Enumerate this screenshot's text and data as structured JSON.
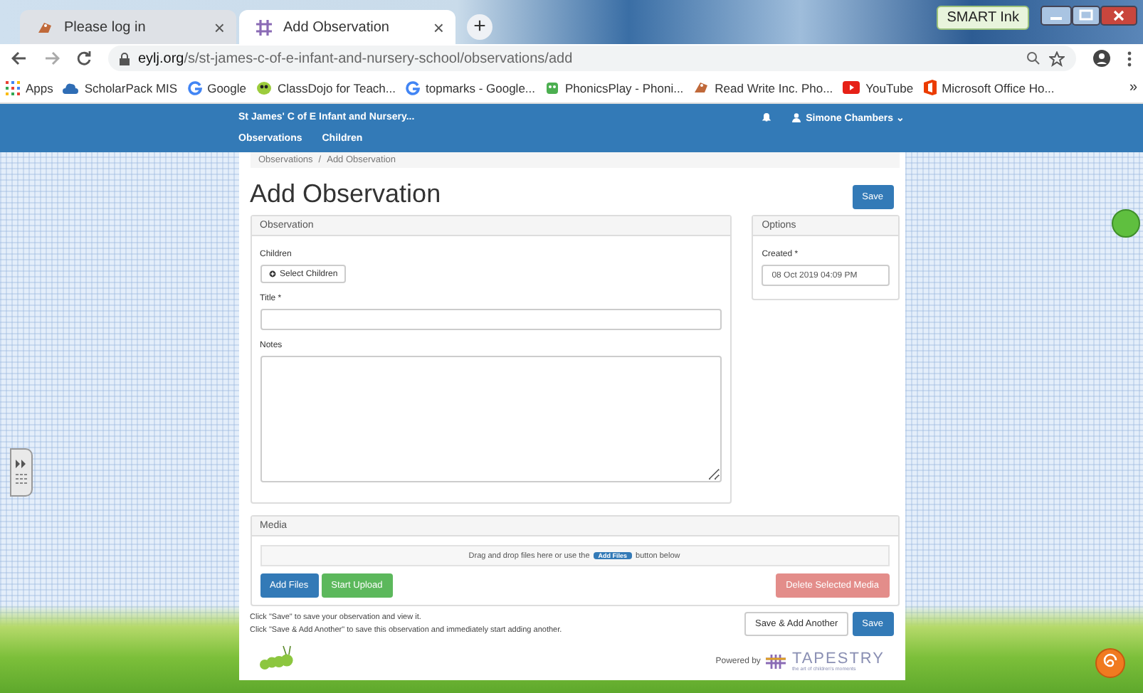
{
  "browser": {
    "tabs": [
      {
        "title": "Please log in",
        "close": "×",
        "selected": false
      },
      {
        "title": "Add Observation",
        "close": "×",
        "selected": true
      }
    ],
    "new_tab": "+",
    "smart_ink": "SMART Ink",
    "url_host": "eylj.org",
    "url_path": "/s/st-james-c-of-e-infant-and-nursery-school/observations/add",
    "bookmarks": [
      {
        "label": "Apps"
      },
      {
        "label": "ScholarPack MIS"
      },
      {
        "label": "Google"
      },
      {
        "label": "ClassDojo for Teach..."
      },
      {
        "label": "topmarks - Google..."
      },
      {
        "label": "PhonicsPlay - Phoni..."
      },
      {
        "label": "Read Write Inc. Pho..."
      },
      {
        "label": "YouTube"
      },
      {
        "label": "Microsoft Office Ho..."
      }
    ],
    "more": "»"
  },
  "app": {
    "school": "St James' C of E Infant and Nursery...",
    "user": "Simone Chambers",
    "user_caret": "⌄",
    "nav": [
      "Observations",
      "Children"
    ],
    "breadcrumb": [
      "Observations",
      "Add Observation"
    ],
    "breadcrumb_separator": "/",
    "heading": "Add Observation",
    "save": "Save",
    "observation": {
      "title": "Observation",
      "children_label": "Children",
      "select_children": "Select Children",
      "title_label": "Title *",
      "notes_label": "Notes"
    },
    "options": {
      "title": "Options",
      "created_label": "Created *",
      "created_value": "08 Oct 2019 04:09 PM"
    },
    "media": {
      "title": "Media",
      "drop_before": "Drag and drop files here or use the",
      "drop_badge": "Add Files",
      "drop_after": "button below",
      "add_files": "Add Files",
      "start_upload": "Start Upload",
      "delete_selected": "Delete Selected Media"
    },
    "help": [
      "Click \"Save\" to save your observation and view it.",
      "Click \"Save & Add Another\" to save this observation and immediately start adding another."
    ],
    "save_add_another": "Save & Add Another",
    "save_bottom": "Save",
    "powered_by": "Powered by",
    "brand": "TAPESTRY",
    "brand_tagline": "the art of children's moments"
  }
}
